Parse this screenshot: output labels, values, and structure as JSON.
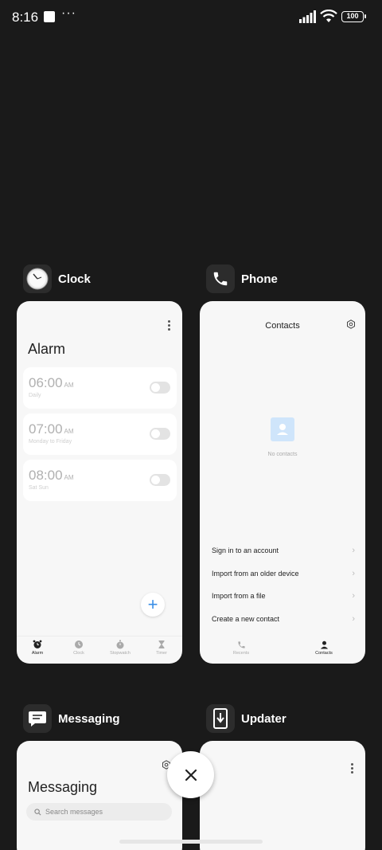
{
  "status_bar": {
    "time": "8:16",
    "more": "···",
    "battery": "100"
  },
  "apps": {
    "clock": {
      "name": "Clock",
      "title": "Alarm",
      "alarms": [
        {
          "time": "06:00",
          "ampm": "AM",
          "repeat": "Daily",
          "enabled": false
        },
        {
          "time": "07:00",
          "ampm": "AM",
          "repeat": "Monday to Friday",
          "enabled": false
        },
        {
          "time": "08:00",
          "ampm": "AM",
          "repeat": "Sat Sun",
          "enabled": false
        }
      ],
      "fab": "+",
      "tabs": [
        {
          "label": "Alarm",
          "icon": "alarm-icon",
          "active": true
        },
        {
          "label": "Clock",
          "icon": "clock-icon",
          "active": false
        },
        {
          "label": "Stopwatch",
          "icon": "stopwatch-icon",
          "active": false
        },
        {
          "label": "Timer",
          "icon": "hourglass-icon",
          "active": false
        }
      ]
    },
    "phone": {
      "name": "Phone",
      "title": "Contacts",
      "empty_text": "No contacts",
      "menu": [
        {
          "label": "Sign in to an account"
        },
        {
          "label": "Import from an older device"
        },
        {
          "label": "Import from a file"
        },
        {
          "label": "Create a new contact"
        }
      ],
      "tabs": [
        {
          "label": "Recents",
          "icon": "phone-icon",
          "active": false
        },
        {
          "label": "Contacts",
          "icon": "person-icon",
          "active": true
        }
      ]
    },
    "messaging": {
      "name": "Messaging",
      "title": "Messaging",
      "search_placeholder": "Search messages"
    },
    "updater": {
      "name": "Updater"
    }
  },
  "colors": {
    "background": "#1a1a1a",
    "card": "#f7f7f7",
    "accent": "#3a8ee6"
  }
}
